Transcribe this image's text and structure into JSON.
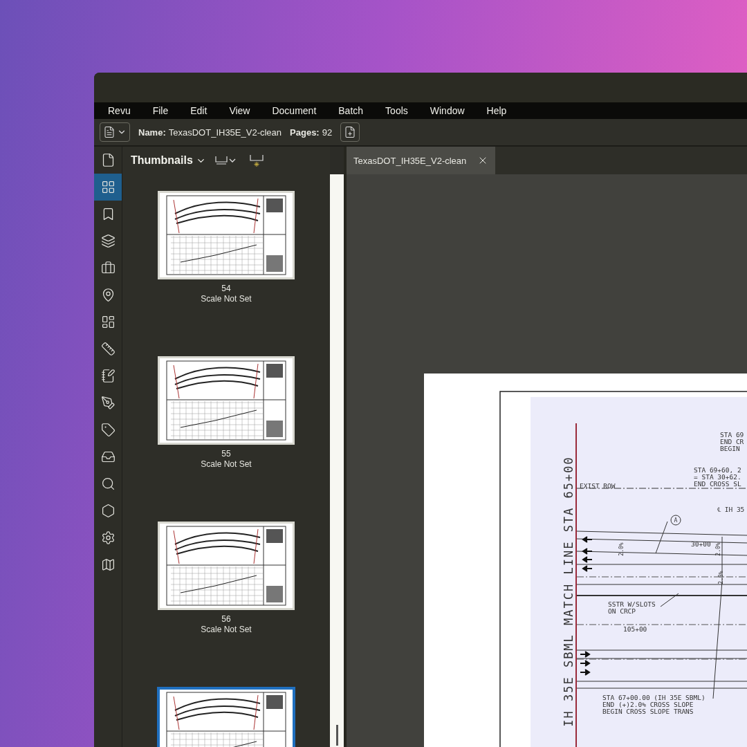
{
  "menu": [
    {
      "label": "Revu"
    },
    {
      "label": "File"
    },
    {
      "label": "Edit"
    },
    {
      "label": "View"
    },
    {
      "label": "Document"
    },
    {
      "label": "Batch"
    },
    {
      "label": "Tools"
    },
    {
      "label": "Window"
    },
    {
      "label": "Help"
    }
  ],
  "toolbar": {
    "name_label": "Name:",
    "name": "TexasDOT_IH35E_V2-clean",
    "pages_label": "Pages:",
    "pages": "92"
  },
  "rail": [
    {
      "selected": false
    },
    {
      "selected": true
    },
    {
      "selected": false
    },
    {
      "selected": false
    },
    {
      "selected": false
    },
    {
      "selected": false
    },
    {
      "selected": false
    },
    {
      "selected": false
    },
    {
      "selected": false
    },
    {
      "selected": false
    },
    {
      "selected": false
    },
    {
      "selected": false
    },
    {
      "selected": false
    },
    {
      "selected": false
    },
    {
      "selected": false
    },
    {
      "selected": false
    }
  ],
  "panel": {
    "title": "Thumbnails"
  },
  "thumbnails": [
    {
      "page": "54",
      "scale": "Scale Not Set",
      "selected": false
    },
    {
      "page": "55",
      "scale": "Scale Not Set",
      "selected": false
    },
    {
      "page": "56",
      "scale": "Scale Not Set",
      "selected": false
    },
    {
      "selected": true
    }
  ],
  "tabs": [
    {
      "label": "TexasDOT_IH35E_V2-clean",
      "selected": true
    }
  ],
  "sheet": {
    "match_line": "IH 35E SBML MATCH LINE STA 65+00",
    "callout": "A",
    "slopes": [
      "2.0%",
      "2.0%",
      "2.0%"
    ],
    "notes": [
      {
        "lines": [
          "STA 69",
          "END CR",
          "BEGIN"
        ]
      },
      {
        "lines": [
          "STA 69+60, 2",
          "= STA 30+62.",
          "END CROSS SL"
        ]
      },
      {
        "lines": [
          "EXIST ROW"
        ]
      },
      {
        "lines": [
          "℄ IH 35"
        ]
      },
      {
        "lines": [
          "30+00"
        ]
      },
      {
        "lines": [
          "SSTR W/SLOTS",
          "ON CRCP"
        ]
      },
      {
        "lines": [
          "105+00"
        ]
      },
      {
        "lines": [
          "STA 67+00.00 (IH 35E SBML)",
          "END (+)2.0% CROSS SLOPE",
          "BEGIN CROSS SLOPE TRANS"
        ]
      }
    ]
  }
}
